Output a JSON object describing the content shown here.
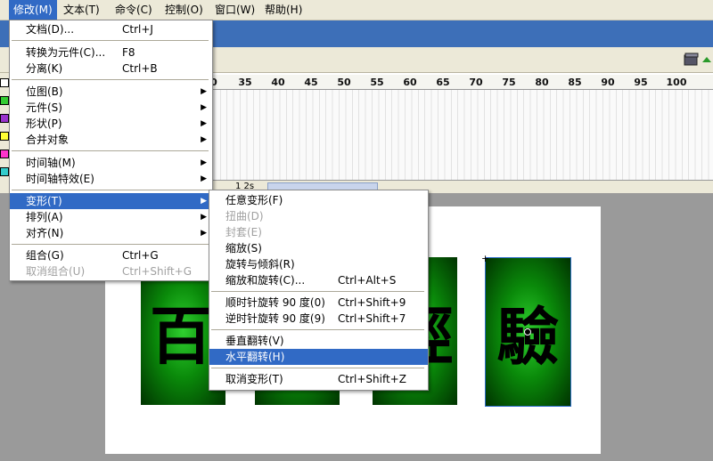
{
  "menubar": {
    "items": [
      "修改(M)",
      "文本(T)",
      "命令(C)",
      "控制(O)",
      "窗口(W)",
      "帮助(H)"
    ]
  },
  "ruler": {
    "ticks": [
      "0",
      "35",
      "40",
      "45",
      "50",
      "55",
      "60",
      "65",
      "70",
      "75",
      "80",
      "85",
      "90",
      "95",
      "100"
    ]
  },
  "timeline_status": "1 2s",
  "modify_menu": {
    "document": {
      "label": "文档(D)...",
      "shortcut": "Ctrl+J"
    },
    "convert_symbol": {
      "label": "转换为元件(C)...",
      "shortcut": "F8"
    },
    "break_apart": {
      "label": "分离(K)",
      "shortcut": "Ctrl+B"
    },
    "bitmap": {
      "label": "位图(B)"
    },
    "symbol": {
      "label": "元件(S)"
    },
    "shape": {
      "label": "形状(P)"
    },
    "combine": {
      "label": "合并对象"
    },
    "timeline": {
      "label": "时间轴(M)"
    },
    "timeline_effects": {
      "label": "时间轴特效(E)"
    },
    "transform": {
      "label": "变形(T)"
    },
    "arrange": {
      "label": "排列(A)"
    },
    "align": {
      "label": "对齐(N)"
    },
    "group": {
      "label": "组合(G)",
      "shortcut": "Ctrl+G"
    },
    "ungroup": {
      "label": "取消组合(U)",
      "shortcut": "Ctrl+Shift+G"
    }
  },
  "transform_menu": {
    "free": {
      "label": "任意变形(F)"
    },
    "distort": {
      "label": "扭曲(D)"
    },
    "envelope": {
      "label": "封套(E)"
    },
    "scale": {
      "label": "缩放(S)"
    },
    "rotate_skew": {
      "label": "旋转与倾斜(R)"
    },
    "scale_rotate": {
      "label": "缩放和旋转(C)...",
      "shortcut": "Ctrl+Alt+S"
    },
    "rotate_cw": {
      "label": "顺时针旋转 90 度(0)",
      "shortcut": "Ctrl+Shift+9"
    },
    "rotate_ccw": {
      "label": "逆时针旋转 90 度(9)",
      "shortcut": "Ctrl+Shift+7"
    },
    "flip_v": {
      "label": "垂直翻转(V)"
    },
    "flip_h": {
      "label": "水平翻转(H)"
    },
    "remove": {
      "label": "取消变形(T)",
      "shortcut": "Ctrl+Shift+Z"
    }
  },
  "stage": {
    "cards": [
      "百",
      "經",
      "驗"
    ]
  },
  "colors": {
    "highlight": "#316ac5",
    "card_green": "#0a8a0a"
  }
}
